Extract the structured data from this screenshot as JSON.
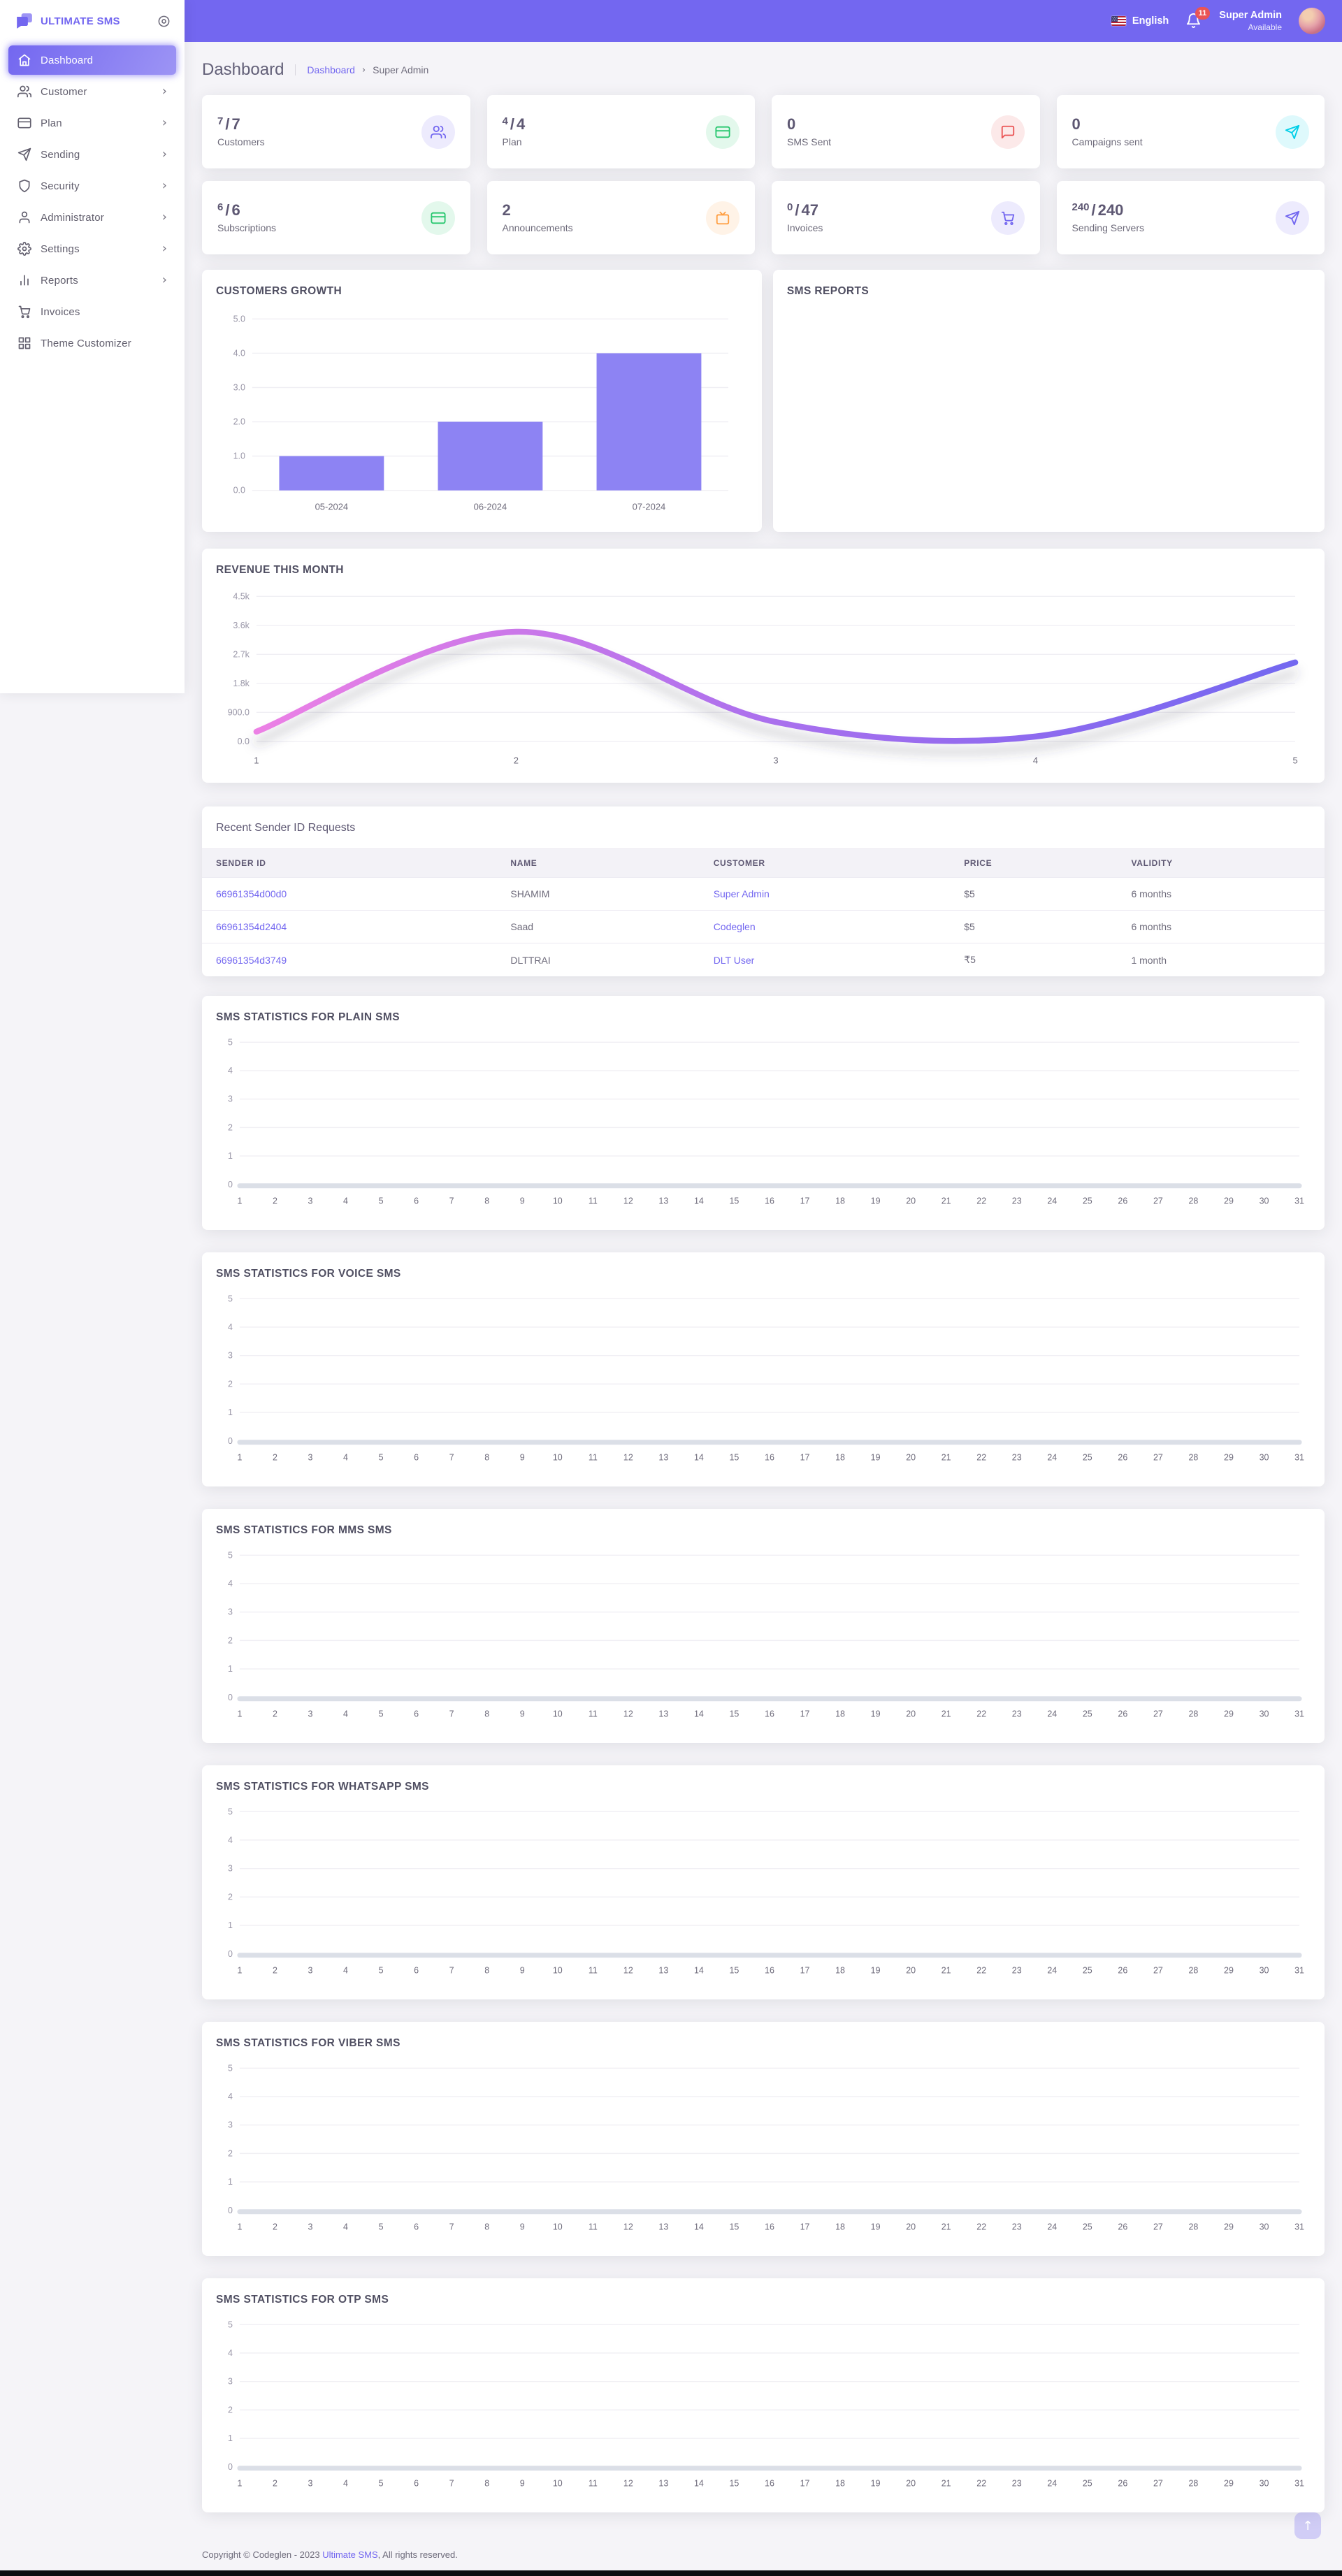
{
  "brand": {
    "name": "ULTIMATE SMS"
  },
  "topbar": {
    "language": "English",
    "notification_count": "11",
    "user": {
      "name": "Super Admin",
      "status": "Available"
    }
  },
  "sidebar": {
    "items": [
      {
        "label": "Dashboard",
        "icon": "home-icon",
        "active": true,
        "has_submenu": false
      },
      {
        "label": "Customer",
        "icon": "users-icon",
        "active": false,
        "has_submenu": true
      },
      {
        "label": "Plan",
        "icon": "credit-card-icon",
        "active": false,
        "has_submenu": true
      },
      {
        "label": "Sending",
        "icon": "send-icon",
        "active": false,
        "has_submenu": true
      },
      {
        "label": "Security",
        "icon": "shield-icon",
        "active": false,
        "has_submenu": true
      },
      {
        "label": "Administrator",
        "icon": "user-icon",
        "active": false,
        "has_submenu": true
      },
      {
        "label": "Settings",
        "icon": "gear-icon",
        "active": false,
        "has_submenu": true
      },
      {
        "label": "Reports",
        "icon": "bar-chart-icon",
        "active": false,
        "has_submenu": true
      },
      {
        "label": "Invoices",
        "icon": "cart-icon",
        "active": false,
        "has_submenu": false
      },
      {
        "label": "Theme Customizer",
        "icon": "grid-icon",
        "active": false,
        "has_submenu": false
      }
    ]
  },
  "page": {
    "title": "Dashboard",
    "breadcrumb": {
      "root": "Dashboard",
      "current": "Super Admin"
    }
  },
  "stat_cards": [
    {
      "value_top": "7",
      "value_main": "7",
      "label": "Customers",
      "icon": "users-icon",
      "accent": "#7367f0"
    },
    {
      "value_top": "4",
      "value_main": "4",
      "label": "Plan",
      "icon": "credit-card-icon",
      "accent": "#28c76f"
    },
    {
      "value_main": "0",
      "label": "SMS Sent",
      "icon": "message-icon",
      "accent": "#ea5455"
    },
    {
      "value_main": "0",
      "label": "Campaigns sent",
      "icon": "send-icon",
      "accent": "#00cfe8"
    },
    {
      "value_top": "6",
      "value_main": "6",
      "label": "Subscriptions",
      "icon": "credit-card-icon",
      "accent": "#28c76f"
    },
    {
      "value_main": "2",
      "label": "Announcements",
      "icon": "tv-icon",
      "accent": "#ff9f43"
    },
    {
      "value_top": "0",
      "value_main": "47",
      "label": "Invoices",
      "icon": "cart-icon",
      "accent": "#7367f0"
    },
    {
      "value_top": "240",
      "value_main": "240",
      "label": "Sending Servers",
      "icon": "send-icon",
      "accent": "#7367f0"
    }
  ],
  "customers_growth": {
    "title": "CUSTOMERS GROWTH",
    "chart_data": {
      "type": "bar",
      "categories": [
        "05-2024",
        "06-2024",
        "07-2024"
      ],
      "values": [
        1,
        2,
        4
      ],
      "ylim": [
        0,
        5
      ],
      "yticks": [
        "0.0",
        "1.0",
        "2.0",
        "3.0",
        "4.0",
        "5.0"
      ],
      "bar_color": "#8d83f3",
      "grid": true,
      "legend": false
    }
  },
  "sms_reports": {
    "title": "SMS REPORTS"
  },
  "revenue": {
    "title": "REVENUE THIS MONTH",
    "chart_data": {
      "type": "line",
      "x": [
        1,
        2,
        3,
        4,
        5
      ],
      "y": [
        300,
        3400,
        600,
        150,
        2450
      ],
      "ylim": [
        0,
        4500
      ],
      "yticks": [
        "0.0",
        "900.0",
        "1.8k",
        "2.7k",
        "3.6k",
        "4.5k"
      ],
      "xticks": [
        "1",
        "2",
        "3",
        "4",
        "5"
      ],
      "line_gradient": [
        "#ec80e5",
        "#7367f0"
      ],
      "grid": true,
      "legend": false
    }
  },
  "sender_table": {
    "title": "Recent Sender ID Requests",
    "headers": [
      "SENDER ID",
      "NAME",
      "CUSTOMER",
      "PRICE",
      "VALIDITY"
    ],
    "rows": [
      {
        "sender_id": "66961354d00d0",
        "name": "SHAMIM",
        "customer": "Super Admin",
        "price": "$5",
        "validity": "6 months"
      },
      {
        "sender_id": "66961354d2404",
        "name": "Saad",
        "customer": "Codeglen",
        "price": "$5",
        "validity": "6 months"
      },
      {
        "sender_id": "66961354d3749",
        "name": "DLTTRAI",
        "customer": "DLT User",
        "price": "₹5",
        "validity": "1 month"
      }
    ]
  },
  "sms_stats": [
    {
      "title": "SMS STATISTICS FOR PLAIN SMS",
      "chart_data": {
        "type": "line",
        "x_range": [
          1,
          31
        ],
        "values_constant": 0,
        "ylim": [
          0,
          5
        ],
        "yticks": [
          "0",
          "1",
          "2",
          "3",
          "4",
          "5"
        ],
        "line_gradient": [
          "#ec80e5",
          "#7367f0"
        ],
        "grid": true
      }
    },
    {
      "title": "SMS STATISTICS FOR VOICE SMS",
      "chart_data": {
        "type": "line",
        "x_range": [
          1,
          31
        ],
        "values_constant": 0,
        "ylim": [
          0,
          5
        ],
        "yticks": [
          "0",
          "1",
          "2",
          "3",
          "4",
          "5"
        ],
        "line_gradient": [
          "#ec80e5",
          "#7367f0"
        ],
        "grid": true
      }
    },
    {
      "title": "SMS STATISTICS FOR MMS SMS",
      "chart_data": {
        "type": "line",
        "x_range": [
          1,
          31
        ],
        "values_constant": 0,
        "ylim": [
          0,
          5
        ],
        "yticks": [
          "0",
          "1",
          "2",
          "3",
          "4",
          "5"
        ],
        "line_gradient": [
          "#ec80e5",
          "#7367f0"
        ],
        "grid": true
      }
    },
    {
      "title": "SMS STATISTICS FOR WHATSAPP SMS",
      "chart_data": {
        "type": "line",
        "x_range": [
          1,
          31
        ],
        "values_constant": 0,
        "ylim": [
          0,
          5
        ],
        "yticks": [
          "0",
          "1",
          "2",
          "3",
          "4",
          "5"
        ],
        "line_gradient": [
          "#ec80e5",
          "#7367f0"
        ],
        "grid": true
      }
    },
    {
      "title": "SMS STATISTICS FOR VIBER SMS",
      "chart_data": {
        "type": "line",
        "x_range": [
          1,
          31
        ],
        "values_constant": 0,
        "ylim": [
          0,
          5
        ],
        "yticks": [
          "0",
          "1",
          "2",
          "3",
          "4",
          "5"
        ],
        "line_gradient": [
          "#ec80e5",
          "#7367f0"
        ],
        "grid": true
      }
    },
    {
      "title": "SMS STATISTICS FOR OTP SMS",
      "chart_data": {
        "type": "line",
        "x_range": [
          1,
          31
        ],
        "values_constant": 0,
        "ylim": [
          0,
          5
        ],
        "yticks": [
          "0",
          "1",
          "2",
          "3",
          "4",
          "5"
        ],
        "line_gradient": [
          "#ec80e5",
          "#7367f0"
        ],
        "grid": true
      }
    }
  ],
  "footer": {
    "prefix": "Copyright © Codeglen - 2023 ",
    "link": "Ultimate SMS",
    "suffix": ", All rights reserved."
  },
  "scroll_top_icon": "↑",
  "colors": {
    "accent": "#7367f0",
    "success": "#28c76f",
    "danger": "#ea5455",
    "info": "#00cfe8",
    "warning": "#ff9f43",
    "heading": "#5e5873",
    "body_text": "#6e6b7b",
    "topbar_bg": "#7367f0",
    "page_bg": "#f5f4f8"
  }
}
